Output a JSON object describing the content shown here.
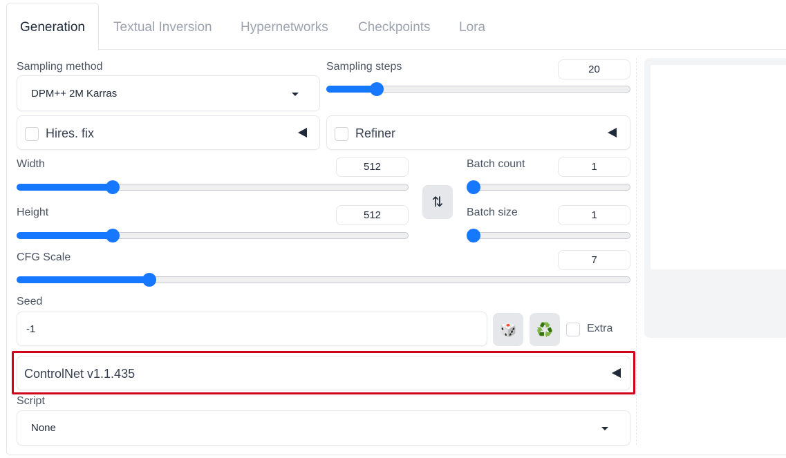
{
  "tabs": [
    {
      "label": "Generation",
      "active": true
    },
    {
      "label": "Textual Inversion",
      "active": false
    },
    {
      "label": "Hypernetworks",
      "active": false
    },
    {
      "label": "Checkpoints",
      "active": false
    },
    {
      "label": "Lora",
      "active": false
    }
  ],
  "sampling_method": {
    "label": "Sampling method",
    "value": "DPM++ 2M Karras"
  },
  "sampling_steps": {
    "label": "Sampling steps",
    "value": "20",
    "slider_fraction": 0.15
  },
  "hires_fix": {
    "label": "Hires. fix",
    "checked": false
  },
  "refiner": {
    "label": "Refiner",
    "checked": false
  },
  "width": {
    "label": "Width",
    "value": "512",
    "slider_fraction": 0.235
  },
  "height": {
    "label": "Height",
    "value": "512",
    "slider_fraction": 0.235
  },
  "swap_button": {
    "icon": "swap-vertical-arrows-icon",
    "glyph": "⇅"
  },
  "batch_count": {
    "label": "Batch count",
    "value": "1",
    "slider_fraction": 0.0
  },
  "batch_size": {
    "label": "Batch size",
    "value": "1",
    "slider_fraction": 0.0
  },
  "cfg_scale": {
    "label": "CFG Scale",
    "value": "7",
    "slider_fraction": 0.21
  },
  "seed": {
    "label": "Seed",
    "value": "-1",
    "extra_label": "Extra",
    "dice_glyph": "🎲",
    "recycle_glyph": "♻️"
  },
  "controlnet": {
    "label": "ControlNet v1.1.435"
  },
  "script": {
    "label": "Script",
    "value": "None"
  },
  "colors": {
    "accent": "#1677ff",
    "highlight": "#d0021b"
  }
}
